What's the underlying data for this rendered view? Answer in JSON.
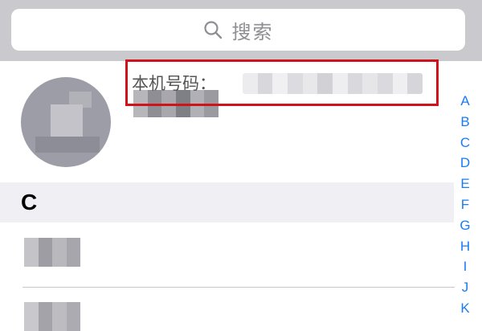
{
  "search": {
    "placeholder": "搜索",
    "icon": "search-icon"
  },
  "my_card": {
    "phone_label": "本机号码："
  },
  "sections": [
    {
      "letter": "C"
    }
  ],
  "index_bar": {
    "letters": [
      "A",
      "B",
      "C",
      "D",
      "E",
      "F",
      "G",
      "H",
      "I",
      "J",
      "K"
    ]
  },
  "colors": {
    "search_bar_bg": "#c9c9ce",
    "highlight_border": "#d0121b",
    "index_letter": "#1a7cf5",
    "section_header_bg": "#efeff4"
  }
}
